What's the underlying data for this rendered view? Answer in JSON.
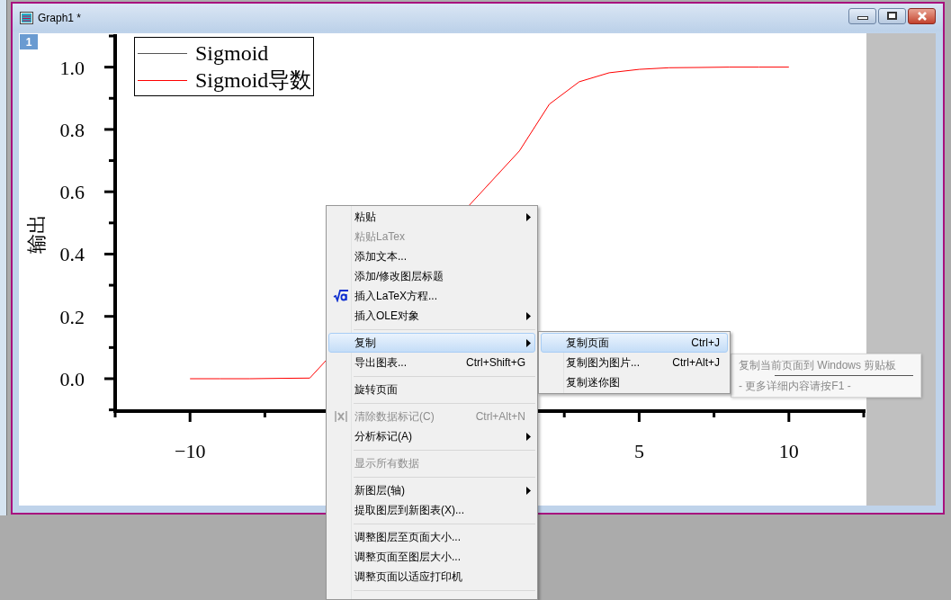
{
  "window": {
    "title": "Graph1 *"
  },
  "layer_badge": "1",
  "plot": {
    "legend": [
      {
        "label": "Sigmoid",
        "color": "#555555"
      },
      {
        "label": "Sigmoid导数",
        "color": "#ff0000"
      }
    ],
    "chart_data": {
      "type": "line",
      "ylabel": "输出",
      "x": [
        -10,
        -9,
        -8,
        -7,
        -6,
        1,
        2,
        3,
        4,
        5,
        6,
        7,
        8,
        9,
        10
      ],
      "series": [
        {
          "color": "#ff0000",
          "values": [
            0.0,
            0.0,
            0.0,
            0.001,
            0.002,
            0.731,
            0.881,
            0.953,
            0.982,
            0.993,
            0.998,
            0.999,
            1.0,
            1.0,
            1.0
          ]
        }
      ],
      "xlim": [
        -12.5,
        12.5
      ],
      "ylim": [
        -0.104,
        1.1
      ],
      "xticks": [
        {
          "value": -10,
          "label": "−10"
        },
        {
          "value": 5,
          "label": "5"
        },
        {
          "value": 10,
          "label": "10"
        }
      ],
      "yticks": [
        {
          "value": 0,
          "label": "0.0"
        },
        {
          "value": 0.2,
          "label": "0.2"
        },
        {
          "value": 0.4,
          "label": "0.4"
        },
        {
          "value": 0.6,
          "label": "0.6"
        },
        {
          "value": 0.8,
          "label": "0.8"
        },
        {
          "value": 1,
          "label": "1.0"
        }
      ]
    }
  },
  "context_menu": {
    "items": [
      {
        "kind": "item",
        "label": "粘贴",
        "submenu": true,
        "disabled": false,
        "selected": false
      },
      {
        "kind": "item",
        "label": "粘贴LaTex",
        "submenu": false,
        "disabled": true,
        "selected": false
      },
      {
        "kind": "item",
        "label": "添加文本...",
        "submenu": false,
        "disabled": false,
        "selected": false
      },
      {
        "kind": "item",
        "label": "添加/修改图层标题",
        "submenu": false,
        "disabled": false,
        "selected": false
      },
      {
        "kind": "item",
        "label": "插入LaTeX方程...",
        "submenu": false,
        "disabled": false,
        "selected": false
      },
      {
        "kind": "item",
        "label": "插入OLE对象",
        "submenu": true,
        "disabled": false,
        "selected": false
      },
      {
        "kind": "separator"
      },
      {
        "kind": "item",
        "label": "复制",
        "submenu": true,
        "disabled": false,
        "selected": true
      },
      {
        "kind": "item",
        "label": "导出图表...",
        "shortcut": "Ctrl+Shift+G",
        "submenu": false,
        "disabled": false,
        "selected": false
      },
      {
        "kind": "separator"
      },
      {
        "kind": "item",
        "label": "旋转页面",
        "submenu": false,
        "disabled": false,
        "selected": false
      },
      {
        "kind": "separator"
      },
      {
        "kind": "item",
        "label": "清除数据标记(C)",
        "shortcut": "Ctrl+Alt+N",
        "submenu": false,
        "disabled": true,
        "selected": false
      },
      {
        "kind": "item",
        "label": "分析标记(A)",
        "submenu": true,
        "disabled": false,
        "selected": false
      },
      {
        "kind": "separator"
      },
      {
        "kind": "item",
        "label": "显示所有数据",
        "submenu": false,
        "disabled": true,
        "selected": false
      },
      {
        "kind": "separator"
      },
      {
        "kind": "item",
        "label": "新图层(轴)",
        "submenu": true,
        "disabled": false,
        "selected": false
      },
      {
        "kind": "item",
        "label": "提取图层到新图表(X)...",
        "submenu": false,
        "disabled": false,
        "selected": false
      },
      {
        "kind": "separator"
      },
      {
        "kind": "item",
        "label": "调整图层至页面大小...",
        "submenu": false,
        "disabled": false,
        "selected": false
      },
      {
        "kind": "item",
        "label": "调整页面至图层大小...",
        "submenu": false,
        "disabled": false,
        "selected": false
      },
      {
        "kind": "item",
        "label": "调整页面以适应打印机",
        "submenu": false,
        "disabled": false,
        "selected": false
      },
      {
        "kind": "separator"
      }
    ]
  },
  "submenu": {
    "items": [
      {
        "label": "复制页面",
        "shortcut": "Ctrl+J",
        "selected": true
      },
      {
        "label": "复制图为图片...",
        "shortcut": "Ctrl+Alt+J",
        "selected": false
      },
      {
        "label": "复制迷你图",
        "selected": false
      }
    ]
  },
  "tooltip": {
    "title": "复制当前页面到 Windows 剪贴板",
    "hint": "- 更多详细内容请按F1 -"
  }
}
